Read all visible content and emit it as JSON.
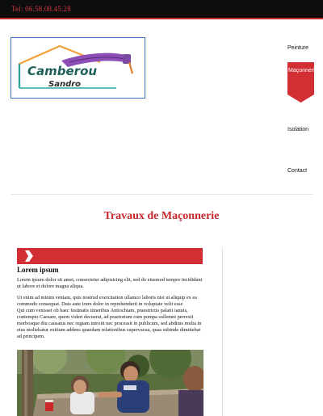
{
  "header": {
    "phone": "Tel: 06.58.08.45.28"
  },
  "logo": {
    "line1": "Camberou",
    "line2": "Sandro"
  },
  "nav": {
    "items": [
      {
        "label": "Peinture",
        "active": false
      },
      {
        "label": "Maçonnerie",
        "active": true
      },
      {
        "label": "Isolation",
        "active": false
      },
      {
        "label": "Contact",
        "active": false
      }
    ]
  },
  "main": {
    "title": "Travaux de Maçonnerie",
    "section": {
      "heading": "Lorem ipsum",
      "para1": "Lorem ipsum dolor sit amet, consectetur adipisicing elit, sed do eiusmod tempor incididunt ut labore et dolore magna aliqua.",
      "para2_line1": "Ut enim ad minim veniam, quis nostrud exercitation ullamco laboris nisi ut aliquip ex ea commodo consequat. Duis aute irure dolor in reprehenderit in voluptate velit esse",
      "para2_line2": "Qui cum venisset ob haec festinatis itineribus Antiochiam, praestrictis palatii ianuis, contempto Caesare, quem videri decuerat, ad praetorium cum pompa sollemni perrexit morbosque diu causatus nec regiam introiit nec processit in publicum, sed abditus multa in eius moliebatur exitium addens quaedam relationibus supervacua, quas subinde dimittebat ad principem."
    }
  },
  "colors": {
    "accent": "#d22f35",
    "topbar": "#0d0d0d",
    "logo_border": "#3d73b9"
  }
}
